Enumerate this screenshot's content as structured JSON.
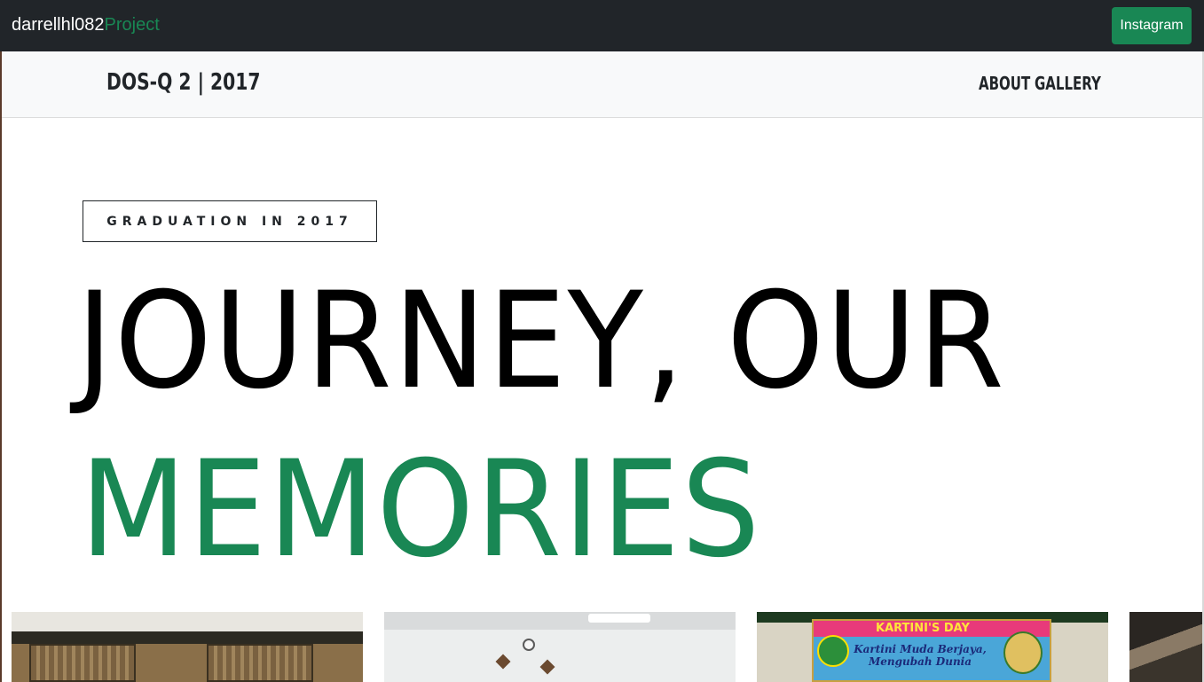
{
  "topbar": {
    "brand_main": "darrellhl082",
    "brand_accent": "Project",
    "instagram_label": "Instagram"
  },
  "subnav": {
    "title": "DOS-Q 2 | 2017",
    "links": [
      {
        "label": "ABOUT"
      },
      {
        "label": "GALLERY"
      }
    ]
  },
  "hero": {
    "tag": "GRADUATION IN 2017",
    "line1": "JOURNEY, OUR",
    "line2": "MEMORIES"
  },
  "gallery": {
    "thumb3": {
      "banner_title": "KARTINI'S DAY",
      "banner_subtitle": "Kartini Muda Berjaya, Mengubah Dunia"
    }
  },
  "colors": {
    "accent": "#198754",
    "topbar_bg": "#212529",
    "subnav_bg": "#f8f9fa"
  }
}
